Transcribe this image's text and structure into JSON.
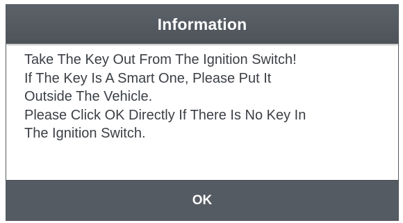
{
  "dialog": {
    "title": "Information",
    "message_lines": [
      "Take The Key Out From The Ignition Switch!",
      "If The Key Is A Smart One, Please Put It",
      "Outside The Vehicle.",
      "Please Click OK Directly If There Is No Key In",
      "The Ignition Switch."
    ],
    "ok_label": "OK"
  },
  "colors": {
    "header_bg": "#50565c",
    "button_bg": "#555b62",
    "text": "#3b3f44"
  }
}
